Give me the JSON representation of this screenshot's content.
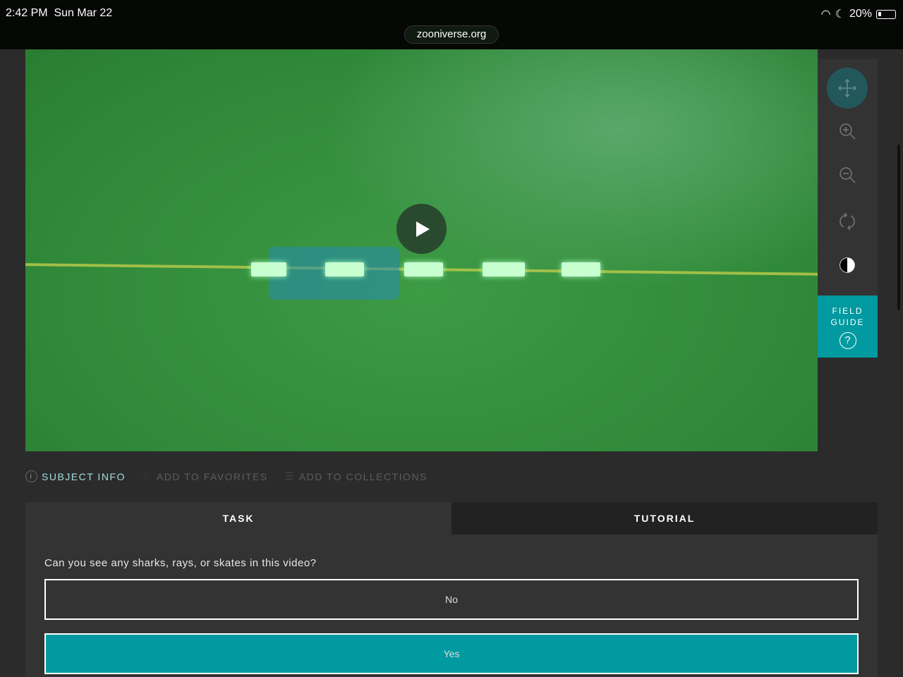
{
  "statusbar": {
    "time": "2:42 PM",
    "date": "Sun Mar 22",
    "battery": "20%",
    "url": "zooniverse.org"
  },
  "toolbar": {
    "field_guide_line1": "FIELD",
    "field_guide_line2": "GUIDE",
    "field_guide_icon": "?"
  },
  "meta": {
    "subject_info": "SUBJECT INFO",
    "favorites": "ADD TO FAVORITES",
    "collections": "ADD TO COLLECTIONS"
  },
  "tabs": {
    "task": "TASK",
    "tutorial": "TUTORIAL"
  },
  "task": {
    "question": "Can you see any sharks, rays, or skates in this video?",
    "answers": [
      "No",
      "Yes"
    ]
  },
  "colors": {
    "accent": "#009aa0",
    "background": "#2b2b2b"
  }
}
